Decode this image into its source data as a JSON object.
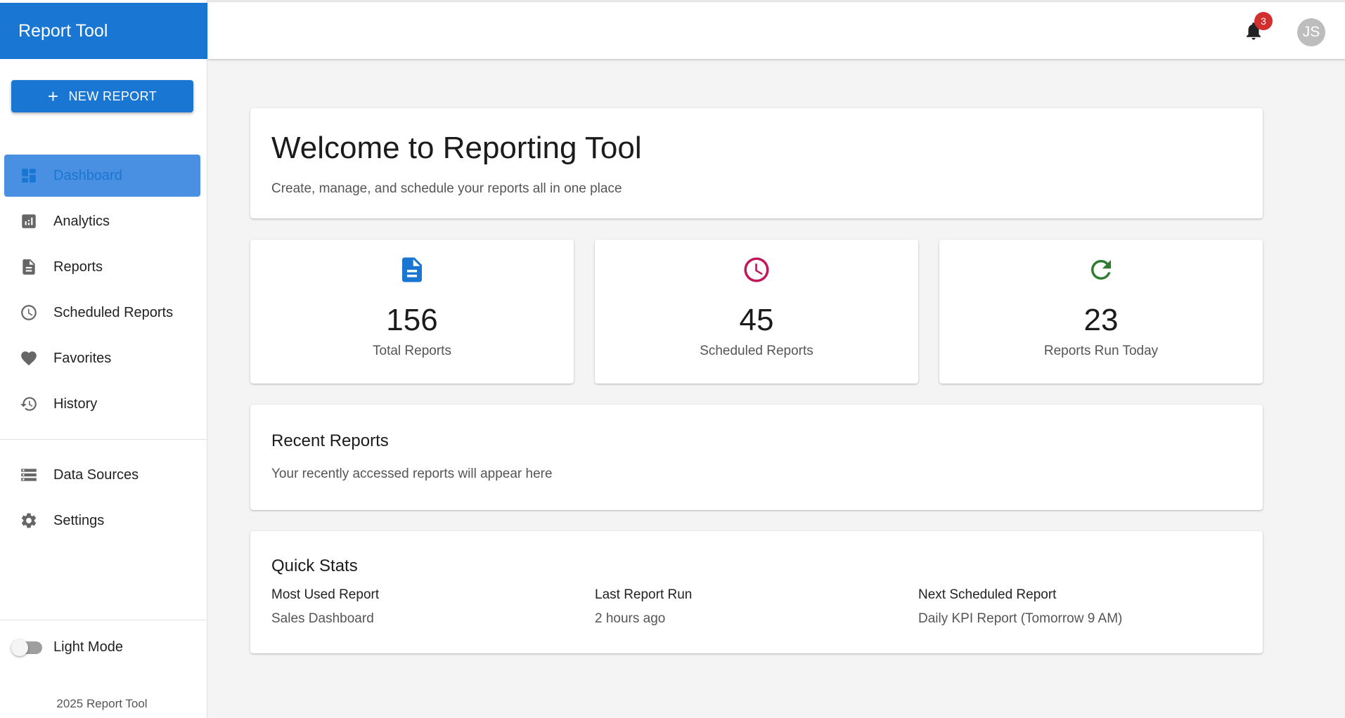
{
  "app": {
    "title": "Report Tool"
  },
  "sidebar": {
    "new_report_label": "NEW REPORT",
    "items": [
      {
        "label": "Dashboard",
        "icon": "dashboard-icon",
        "active": true
      },
      {
        "label": "Analytics",
        "icon": "analytics-icon",
        "active": false
      },
      {
        "label": "Reports",
        "icon": "document-icon",
        "active": false
      },
      {
        "label": "Scheduled Reports",
        "icon": "clock-icon",
        "active": false
      },
      {
        "label": "Favorites",
        "icon": "heart-icon",
        "active": false
      },
      {
        "label": "History",
        "icon": "history-icon",
        "active": false
      }
    ],
    "secondary_items": [
      {
        "label": "Data Sources",
        "icon": "storage-icon"
      },
      {
        "label": "Settings",
        "icon": "gear-icon"
      }
    ],
    "theme_toggle_label": "Light Mode",
    "footer": "2025 Report Tool"
  },
  "topbar": {
    "notification_count": "3",
    "avatar_initials": "JS"
  },
  "welcome": {
    "title": "Welcome to Reporting Tool",
    "subtitle": "Create, manage, and schedule your reports all in one place"
  },
  "stats": [
    {
      "value": "156",
      "label": "Total Reports",
      "icon": "document-icon",
      "color": "#1976d2"
    },
    {
      "value": "45",
      "label": "Scheduled Reports",
      "icon": "clock-icon",
      "color": "#c2185b"
    },
    {
      "value": "23",
      "label": "Reports Run Today",
      "icon": "refresh-icon",
      "color": "#2e7d32"
    }
  ],
  "recent": {
    "title": "Recent Reports",
    "empty_text": "Your recently accessed reports will appear here"
  },
  "quick_stats": {
    "title": "Quick Stats",
    "items": [
      {
        "label": "Most Used Report",
        "value": "Sales Dashboard"
      },
      {
        "label": "Last Report Run",
        "value": "2 hours ago"
      },
      {
        "label": "Next Scheduled Report",
        "value": "Daily KPI Report (Tomorrow 9 AM)"
      }
    ]
  },
  "colors": {
    "primary": "#1976d2",
    "active_bg": "#4a90e2",
    "badge": "#d32f2f",
    "scheduled": "#c2185b",
    "success": "#2e7d32"
  }
}
